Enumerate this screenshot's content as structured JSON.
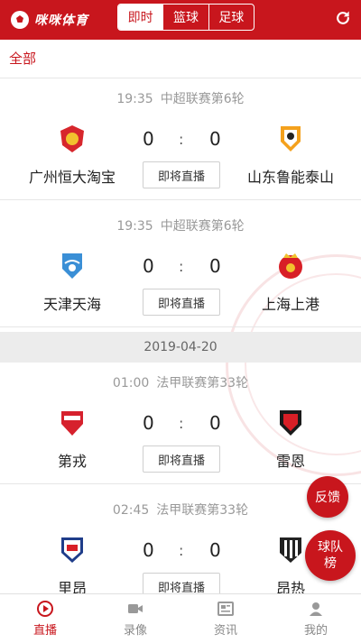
{
  "header": {
    "brand": "咪咪体育",
    "tabs": [
      {
        "label": "即时",
        "active": true
      },
      {
        "label": "篮球",
        "active": false
      },
      {
        "label": "足球",
        "active": false
      }
    ],
    "refresh_icon": "refresh-icon"
  },
  "filter": {
    "label": "全部"
  },
  "colors": {
    "accent": "#c8161d",
    "muted": "#999999",
    "divider": "#e6e6e6"
  },
  "matches": [
    {
      "time": "19:35",
      "league": "中超联赛第6轮",
      "home": "广州恒大淘宝",
      "away": "山东鲁能泰山",
      "home_score": "0",
      "separator": ":",
      "away_score": "0",
      "status": "即将直播"
    },
    {
      "time": "19:35",
      "league": "中超联赛第6轮",
      "home": "天津天海",
      "away": "上海上港",
      "home_score": "0",
      "separator": ":",
      "away_score": "0",
      "status": "即将直播"
    },
    {
      "time": "01:00",
      "league": "法甲联赛第33轮",
      "home": "第戎",
      "away": "雷恩",
      "home_score": "0",
      "separator": ":",
      "away_score": "0",
      "status": "即将直播"
    },
    {
      "time": "02:45",
      "league": "法甲联赛第33轮",
      "home": "里昂",
      "away": "昂热",
      "home_score": "0",
      "separator": ":",
      "away_score": "0",
      "status": "即将直播"
    }
  ],
  "date_divider": "2019-04-20",
  "fabs": {
    "feedback": "反馈",
    "rank_line1": "球队",
    "rank_line2": "榜"
  },
  "bottom_nav": [
    {
      "label": "直播",
      "icon": "play-circle-icon",
      "active": true
    },
    {
      "label": "录像",
      "icon": "video-camera-icon",
      "active": false
    },
    {
      "label": "资讯",
      "icon": "news-icon",
      "active": false
    },
    {
      "label": "我的",
      "icon": "user-icon",
      "active": false
    }
  ]
}
